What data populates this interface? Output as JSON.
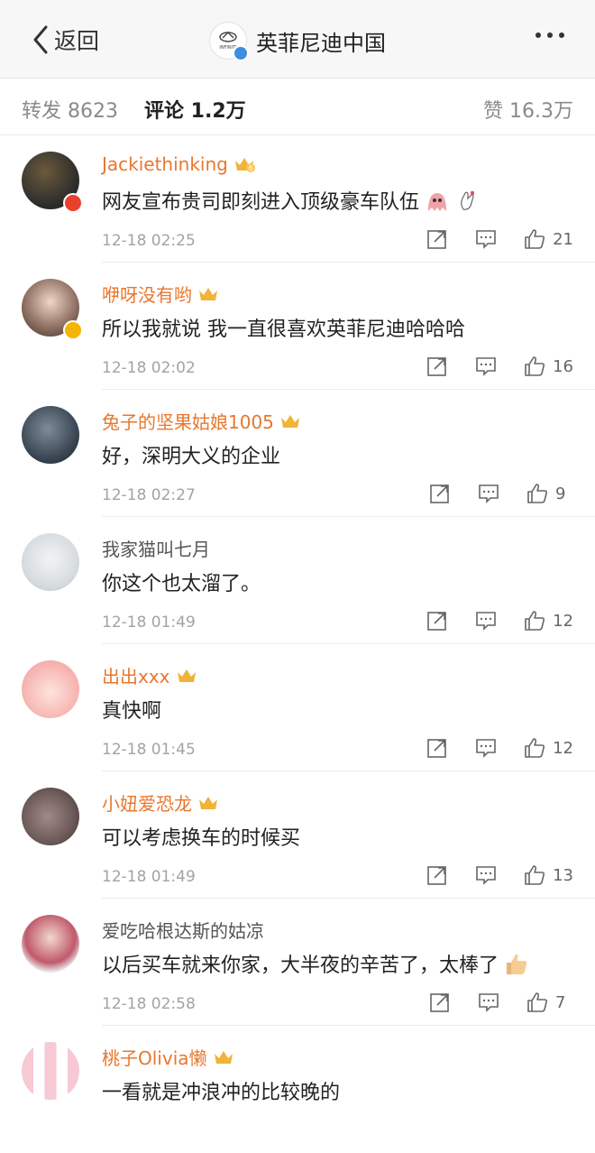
{
  "navbar": {
    "back_label": "返回",
    "title": "英菲尼迪中国",
    "logo_text": "INFINITI"
  },
  "tabs": {
    "repost": "转发 8623",
    "comment": "评论 1.2万",
    "like": "赞 16.3万"
  },
  "colors": {
    "username": "#e8772e",
    "timestamp": "#a3a3a3",
    "verified_blue": "#3d8ede",
    "verified_yellow": "#f5b400",
    "badge_red": "#e8412b"
  },
  "comments": [
    {
      "user": "Jackiethinking",
      "text": "网友宣布贵司即刻进入顶级豪车队伍",
      "time": "12-18 02:25",
      "likes": "21",
      "crown_level": "6",
      "emojis": [
        "ghost-emoji",
        "hand-heart-emoji"
      ],
      "badge": "red-star-badge"
    },
    {
      "user": "咿呀没有哟",
      "text": "所以我就说 我一直很喜欢英菲尼迪哈哈哈",
      "time": "12-18 02:02",
      "likes": "16",
      "badge": "yellow-verified-badge"
    },
    {
      "user": "兔子的坚果姑娘1005",
      "text": "好，深明大义的企业",
      "time": "12-18 02:27",
      "likes": "9"
    },
    {
      "user": "我家猫叫七月",
      "text": "你这个也太溜了。",
      "time": "12-18 01:49",
      "likes": "12",
      "plain": true
    },
    {
      "user": "出出xxx",
      "text": "真快啊",
      "time": "12-18 01:45",
      "likes": "12"
    },
    {
      "user": "小妞爱恐龙",
      "text": "可以考虑换车的时候买",
      "time": "12-18 01:49",
      "likes": "13"
    },
    {
      "user": "爱吃哈根达斯的姑凉",
      "text": "以后买车就来你家，大半夜的辛苦了，太棒了",
      "time": "12-18 02:58",
      "likes": "7",
      "plain": true,
      "emojis": [
        "thumbs-up-emoji"
      ]
    },
    {
      "user": "桃子Olivia懒",
      "text": "一看就是冲浪冲的比较晚的",
      "time": "",
      "likes": ""
    }
  ]
}
